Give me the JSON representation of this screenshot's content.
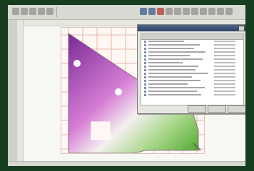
{
  "app": {
    "accent": "#2c4366"
  },
  "dialog": {
    "rows": [
      {
        "label": "",
        "value": ""
      },
      {
        "label": "",
        "value": ""
      },
      {
        "label": "",
        "value": ""
      },
      {
        "label": "",
        "value": ""
      },
      {
        "label": "",
        "value": ""
      },
      {
        "label": "",
        "value": ""
      },
      {
        "label": "",
        "value": ""
      },
      {
        "label": "",
        "value": ""
      },
      {
        "label": "",
        "value": ""
      },
      {
        "label": "",
        "value": ""
      },
      {
        "label": "",
        "value": ""
      },
      {
        "label": "",
        "value": ""
      },
      {
        "label": "",
        "value": ""
      },
      {
        "label": "",
        "value": ""
      },
      {
        "label": "",
        "value": ""
      },
      {
        "label": "",
        "value": ""
      }
    ]
  },
  "colors": {
    "purple": "#8f3aa8",
    "green": "#6fbe3d",
    "grid": "#e6b8a8"
  }
}
